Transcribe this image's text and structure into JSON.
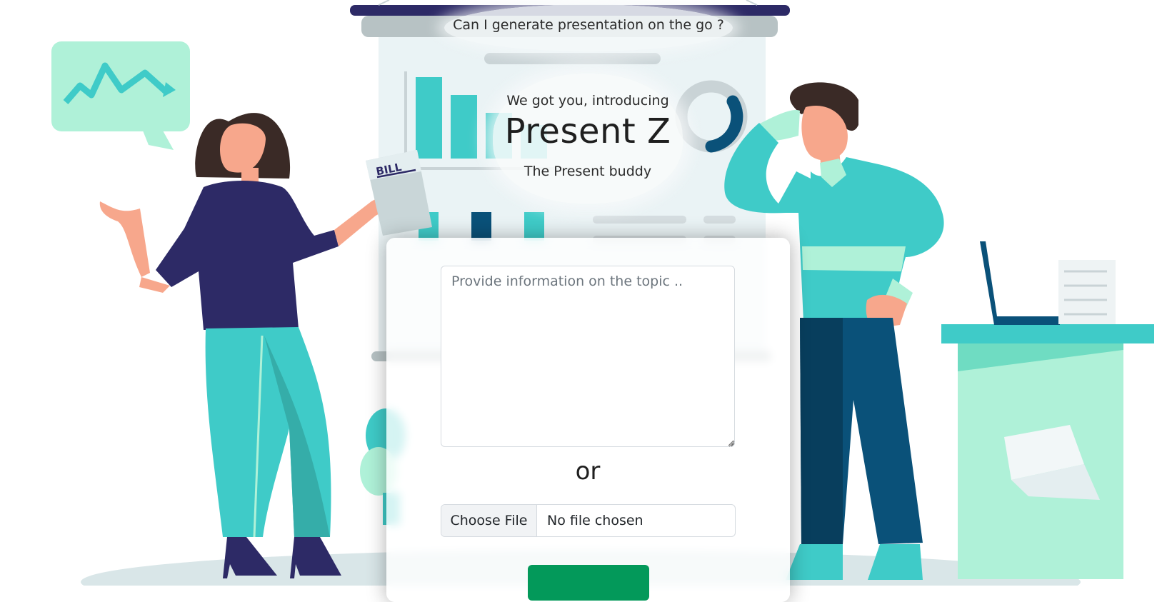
{
  "banner": {
    "question": "Can I generate presentation on the go ?"
  },
  "hero": {
    "intro": "We got you, introducing",
    "title": "Present Z",
    "subtitle": "The Present buddy"
  },
  "illustration": {
    "bill_label": "BILL"
  },
  "form": {
    "topic_placeholder": "Provide information on the topic ..",
    "topic_value": "",
    "separator": "or",
    "file_button_label": "Choose File",
    "file_status": "No file chosen",
    "submit_label": ""
  },
  "colors": {
    "navy": "#2d2a66",
    "teal": "#3fcbc8",
    "mint": "#aff1d8",
    "dark_blue": "#0a5179",
    "submit_green": "#03995a"
  }
}
